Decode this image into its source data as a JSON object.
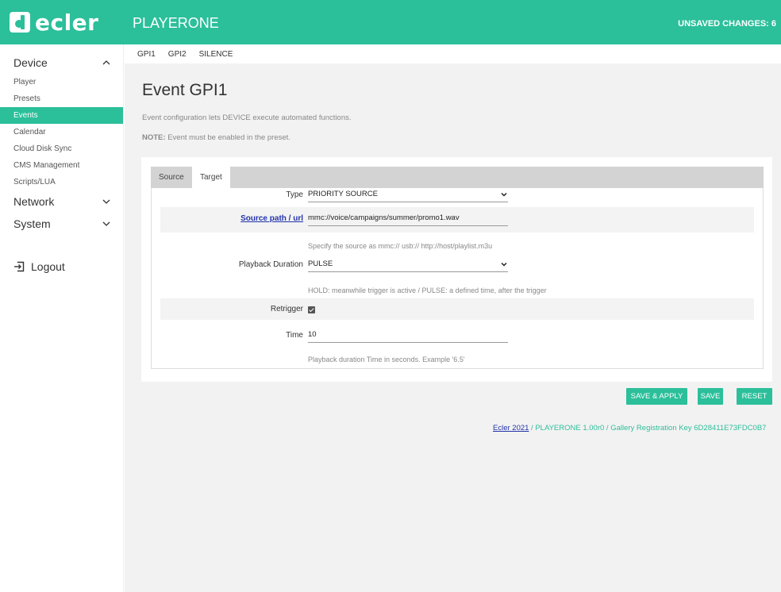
{
  "header": {
    "logo_text": "ecler",
    "app_title": "PLAYERONE",
    "unsaved": "UNSAVED CHANGES: 6",
    "color": "#2bbf9a"
  },
  "sidebar": {
    "device_label": "Device",
    "device_items": [
      "Player",
      "Presets",
      "Events",
      "Calendar",
      "Cloud Disk Sync",
      "CMS Management",
      "Scripts/LUA"
    ],
    "active_item": "Events",
    "network_label": "Network",
    "system_label": "System",
    "logout_label": "Logout"
  },
  "subtabs": [
    "GPI1",
    "GPI2",
    "SILENCE"
  ],
  "page": {
    "title": "Event GPI1",
    "description": "Event configuration lets DEVICE execute automated functions.",
    "note_bold": "NOTE:",
    "note_text": " Event must be enabled in the preset."
  },
  "tabs": {
    "source": "Source",
    "target": "Target"
  },
  "form": {
    "type_label": "Type",
    "type_value": "PRIORITY SOURCE",
    "source_label": "Source path / url",
    "source_value": "mmc://voice/campaigns/summer/promo1.wav",
    "source_hint": "Specify the source as mmc:// usb:// http://host/playlist.m3u",
    "duration_label": "Playback Duration",
    "duration_value": "PULSE",
    "duration_hint": "HOLD: meanwhile trigger is active / PULSE: a defined time, after the trigger",
    "retrigger_label": "Retrigger",
    "retrigger_checked": true,
    "time_label": "Time",
    "time_value": "10",
    "time_hint": "Playback duration Time in seconds. Example '6.5'"
  },
  "buttons": {
    "save_apply": "SAVE & APPLY",
    "save": "SAVE",
    "reset": "RESET"
  },
  "footer": {
    "link": "Ecler 2021",
    "text": " / PLAYERONE 1.00r0 / Gallery Registration Key 6D28411E73FDC0B7"
  }
}
